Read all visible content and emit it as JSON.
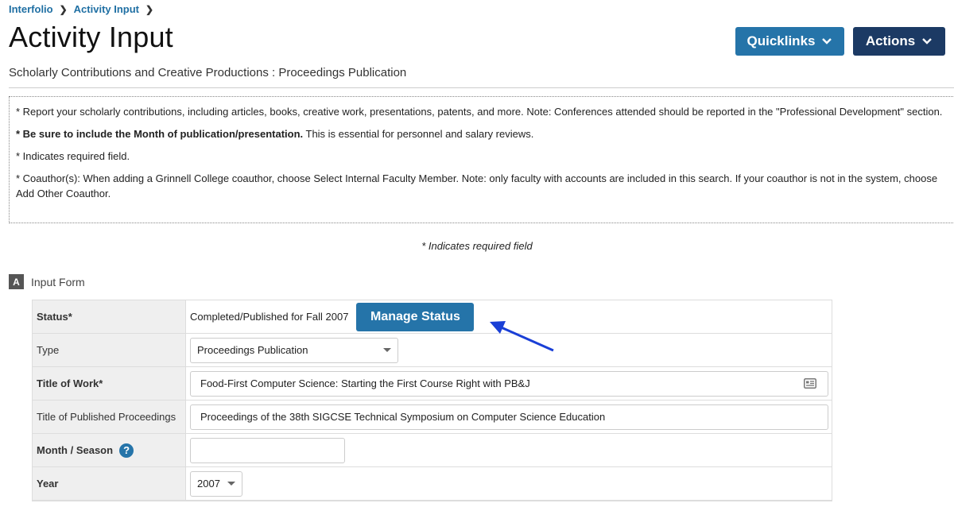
{
  "breadcrumb": {
    "items": [
      "Interfolio",
      "Activity Input"
    ]
  },
  "header": {
    "title": "Activity Input",
    "quicklinks_label": "Quicklinks",
    "actions_label": "Actions",
    "subtitle": "Scholarly Contributions and Creative Productions : Proceedings Publication"
  },
  "notice": {
    "line1": "* Report your scholarly contributions, including articles, books, creative work, presentations, patents, and more. Note: Conferences attended should be reported in the \"Professional Development\" section.",
    "line2_bold": "* Be sure to include the Month of publication/presentation.",
    "line2_rest": " This is essential for personnel and salary reviews.",
    "line3": "* Indicates required field.",
    "line4": "* Coauthor(s): When adding a Grinnell College coauthor, choose Select Internal Faculty Member. Note: only faculty with accounts are included in this search. If your coauthor is not in the system, choose Add Other Coauthor."
  },
  "required_note": "* Indicates required field",
  "section": {
    "badge": "A",
    "label": "Input Form"
  },
  "form": {
    "status_label": "Status*",
    "status_value": "Completed/Published for Fall 2007",
    "manage_status_label": "Manage Status",
    "type_label": "Type",
    "type_value": "Proceedings Publication",
    "title_label": "Title of Work*",
    "title_value": "Food-First Computer Science: Starting the First Course Right with PB&J",
    "proceedings_label": "Title of Published Proceedings",
    "proceedings_value": "Proceedings of the 38th SIGCSE Technical Symposium on Computer Science Education",
    "month_label": "Month / Season",
    "month_value": "",
    "year_label": "Year",
    "year_value": "2007"
  },
  "colors": {
    "primary": "#2574a9",
    "dark": "#1c3a64",
    "arrow": "#1a3fd6"
  },
  "icons": [
    "chevron-right-icon",
    "chevron-down-icon",
    "caret-down-icon",
    "card-icon",
    "help-icon",
    "arrow-annotation"
  ]
}
